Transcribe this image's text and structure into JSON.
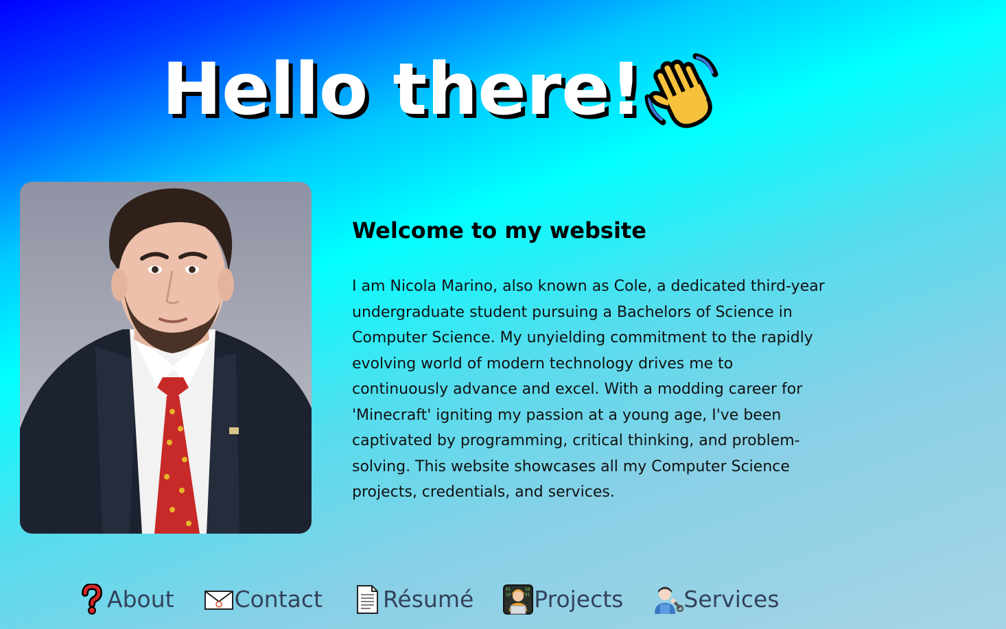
{
  "hero": {
    "title": "Hello there!",
    "icon": "waving-hand-icon"
  },
  "profile": {
    "photo": "profile-photo",
    "heading": "Welcome to my website",
    "bio": "I am Nicola Marino, also known as Cole, a dedicated third-year undergraduate student pursuing a Bachelors of Science in Computer Science. My unyielding commitment to the rapidly evolving world of modern technology drives me to continuously advance and excel. With a modding career for 'Minecraft' igniting my passion at a young age, I've been captivated by programming, critical thinking, and problem-solving. This website showcases all my Computer Science projects, credentials, and services."
  },
  "nav": {
    "items": [
      {
        "label": "About",
        "icon": "question-mark-icon"
      },
      {
        "label": "Contact",
        "icon": "envelope-icon"
      },
      {
        "label": "Résumé",
        "icon": "document-icon"
      },
      {
        "label": "Projects",
        "icon": "technologist-icon"
      },
      {
        "label": "Services",
        "icon": "mechanic-icon"
      }
    ]
  },
  "colors": {
    "gradient_start": "#0000ff",
    "gradient_mid": "#00ffff",
    "gradient_end": "#a6d4e4",
    "title_text": "#ffffff",
    "title_shadow": "#000000",
    "nav_text": "#33425a"
  }
}
